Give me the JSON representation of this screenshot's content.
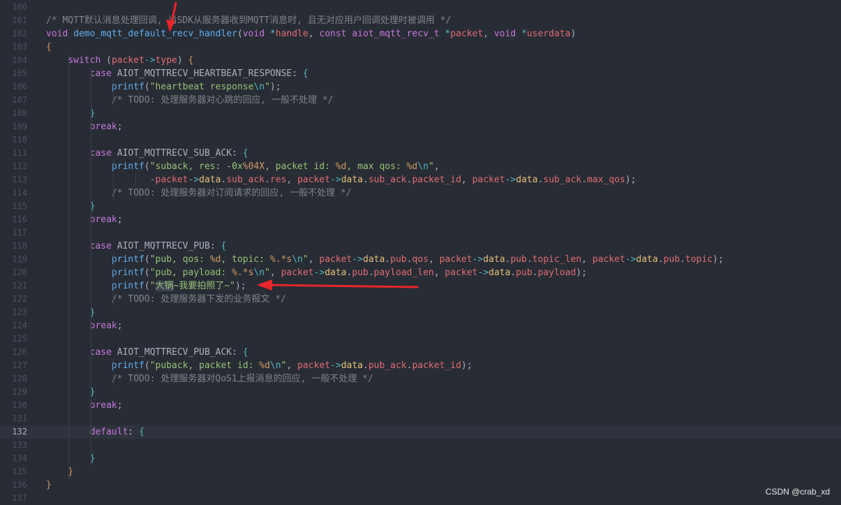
{
  "editor": {
    "current_line": 132,
    "colors": {
      "background": "#282c34",
      "comment": "#7f848e",
      "keyword": "#c678dd",
      "function": "#61afef",
      "string": "#98c379",
      "param": "#e06c75",
      "annotation_arrow": "#e8252a"
    },
    "lines": [
      {
        "num": "100",
        "tokens": []
      },
      {
        "num": "101",
        "tokens": [
          {
            "t": "comment",
            "v": "/* MQTT默认消息处理回调, 当SDK从服务器收到MQTT消息时, 且无对应用户回调处理时被调用 */"
          }
        ]
      },
      {
        "num": "102",
        "tokens": [
          {
            "t": "type",
            "v": "void"
          },
          {
            "t": "plain",
            "v": " "
          },
          {
            "t": "function",
            "v": "demo_mqtt_default_recv_handler"
          },
          {
            "t": "plain",
            "v": "("
          },
          {
            "t": "type",
            "v": "void"
          },
          {
            "t": "plain",
            "v": " "
          },
          {
            "t": "operator",
            "v": "*"
          },
          {
            "t": "param",
            "v": "handle"
          },
          {
            "t": "plain",
            "v": ", "
          },
          {
            "t": "type",
            "v": "const"
          },
          {
            "t": "plain",
            "v": " "
          },
          {
            "t": "type",
            "v": "aiot_mqtt_recv_t"
          },
          {
            "t": "plain",
            "v": " "
          },
          {
            "t": "operator",
            "v": "*"
          },
          {
            "t": "param",
            "v": "packet"
          },
          {
            "t": "plain",
            "v": ", "
          },
          {
            "t": "type",
            "v": "void"
          },
          {
            "t": "plain",
            "v": " "
          },
          {
            "t": "operator",
            "v": "*"
          },
          {
            "t": "param",
            "v": "userdata"
          },
          {
            "t": "plain",
            "v": ")"
          }
        ]
      },
      {
        "num": "103",
        "tokens": [
          {
            "t": "bracket",
            "v": "{"
          }
        ]
      },
      {
        "num": "104",
        "tokens": [
          {
            "t": "plain",
            "v": "    "
          },
          {
            "t": "keyword",
            "v": "switch"
          },
          {
            "t": "plain",
            "v": " ("
          },
          {
            "t": "param",
            "v": "packet"
          },
          {
            "t": "operator",
            "v": "->"
          },
          {
            "t": "field",
            "v": "type"
          },
          {
            "t": "plain",
            "v": ") "
          },
          {
            "t": "bracket",
            "v": "{"
          }
        ]
      },
      {
        "num": "105",
        "tokens": [
          {
            "t": "plain",
            "v": "        "
          },
          {
            "t": "keyword",
            "v": "case"
          },
          {
            "t": "plain",
            "v": " AIOT_MQTTRECV_HEARTBEAT_RESPONSE: "
          },
          {
            "t": "escape",
            "v": "{"
          }
        ]
      },
      {
        "num": "106",
        "tokens": [
          {
            "t": "plain",
            "v": "            "
          },
          {
            "t": "function",
            "v": "printf"
          },
          {
            "t": "plain",
            "v": "("
          },
          {
            "t": "string",
            "v": "\"heartbeat response"
          },
          {
            "t": "escape",
            "v": "\\n"
          },
          {
            "t": "string",
            "v": "\""
          },
          {
            "t": "plain",
            "v": ");"
          }
        ]
      },
      {
        "num": "107",
        "tokens": [
          {
            "t": "plain",
            "v": "            "
          },
          {
            "t": "comment",
            "v": "/* TODO: 处理服务器对心跳的回应, 一般不处理 */"
          }
        ]
      },
      {
        "num": "108",
        "tokens": [
          {
            "t": "plain",
            "v": "        "
          },
          {
            "t": "escape",
            "v": "}"
          }
        ]
      },
      {
        "num": "109",
        "tokens": [
          {
            "t": "plain",
            "v": "        "
          },
          {
            "t": "keyword",
            "v": "break"
          },
          {
            "t": "plain",
            "v": ";"
          }
        ]
      },
      {
        "num": "110",
        "tokens": []
      },
      {
        "num": "111",
        "tokens": [
          {
            "t": "plain",
            "v": "        "
          },
          {
            "t": "keyword",
            "v": "case"
          },
          {
            "t": "plain",
            "v": " AIOT_MQTTRECV_SUB_ACK: "
          },
          {
            "t": "escape",
            "v": "{"
          }
        ]
      },
      {
        "num": "112",
        "tokens": [
          {
            "t": "plain",
            "v": "            "
          },
          {
            "t": "function",
            "v": "printf"
          },
          {
            "t": "plain",
            "v": "("
          },
          {
            "t": "string",
            "v": "\"suback, res: -0x"
          },
          {
            "t": "format",
            "v": "%04X"
          },
          {
            "t": "string",
            "v": ", packet id: "
          },
          {
            "t": "format",
            "v": "%d"
          },
          {
            "t": "string",
            "v": ", max qos: "
          },
          {
            "t": "format",
            "v": "%d"
          },
          {
            "t": "escape",
            "v": "\\n"
          },
          {
            "t": "string",
            "v": "\""
          },
          {
            "t": "plain",
            "v": ","
          }
        ]
      },
      {
        "num": "113",
        "tokens": [
          {
            "t": "plain",
            "v": "                   "
          },
          {
            "t": "operator",
            "v": "-"
          },
          {
            "t": "param",
            "v": "packet"
          },
          {
            "t": "operator",
            "v": "->"
          },
          {
            "t": "constant",
            "v": "data"
          },
          {
            "t": "plain",
            "v": "."
          },
          {
            "t": "field",
            "v": "sub_ack"
          },
          {
            "t": "plain",
            "v": "."
          },
          {
            "t": "field",
            "v": "res"
          },
          {
            "t": "plain",
            "v": ", "
          },
          {
            "t": "param",
            "v": "packet"
          },
          {
            "t": "operator",
            "v": "->"
          },
          {
            "t": "constant",
            "v": "data"
          },
          {
            "t": "plain",
            "v": "."
          },
          {
            "t": "field",
            "v": "sub_ack"
          },
          {
            "t": "plain",
            "v": "."
          },
          {
            "t": "field",
            "v": "packet_id"
          },
          {
            "t": "plain",
            "v": ", "
          },
          {
            "t": "param",
            "v": "packet"
          },
          {
            "t": "operator",
            "v": "->"
          },
          {
            "t": "constant",
            "v": "data"
          },
          {
            "t": "plain",
            "v": "."
          },
          {
            "t": "field",
            "v": "sub_ack"
          },
          {
            "t": "plain",
            "v": "."
          },
          {
            "t": "field",
            "v": "max_qos"
          },
          {
            "t": "plain",
            "v": ");"
          }
        ]
      },
      {
        "num": "114",
        "tokens": [
          {
            "t": "plain",
            "v": "            "
          },
          {
            "t": "comment",
            "v": "/* TODO: 处理服务器对订阅请求的回应, 一般不处理 */"
          }
        ]
      },
      {
        "num": "115",
        "tokens": [
          {
            "t": "plain",
            "v": "        "
          },
          {
            "t": "escape",
            "v": "}"
          }
        ]
      },
      {
        "num": "116",
        "tokens": [
          {
            "t": "plain",
            "v": "        "
          },
          {
            "t": "keyword",
            "v": "break"
          },
          {
            "t": "plain",
            "v": ";"
          }
        ]
      },
      {
        "num": "117",
        "tokens": []
      },
      {
        "num": "118",
        "tokens": [
          {
            "t": "plain",
            "v": "        "
          },
          {
            "t": "keyword",
            "v": "case"
          },
          {
            "t": "plain",
            "v": " AIOT_MQTTRECV_PUB: "
          },
          {
            "t": "escape",
            "v": "{"
          }
        ]
      },
      {
        "num": "119",
        "tokens": [
          {
            "t": "plain",
            "v": "            "
          },
          {
            "t": "function",
            "v": "printf"
          },
          {
            "t": "plain",
            "v": "("
          },
          {
            "t": "string",
            "v": "\"pub, qos: "
          },
          {
            "t": "format",
            "v": "%d"
          },
          {
            "t": "string",
            "v": ", topic: "
          },
          {
            "t": "format",
            "v": "%.*s"
          },
          {
            "t": "escape",
            "v": "\\n"
          },
          {
            "t": "string",
            "v": "\""
          },
          {
            "t": "plain",
            "v": ", "
          },
          {
            "t": "param",
            "v": "packet"
          },
          {
            "t": "operator",
            "v": "->"
          },
          {
            "t": "constant",
            "v": "data"
          },
          {
            "t": "plain",
            "v": "."
          },
          {
            "t": "field",
            "v": "pub"
          },
          {
            "t": "plain",
            "v": "."
          },
          {
            "t": "field",
            "v": "qos"
          },
          {
            "t": "plain",
            "v": ", "
          },
          {
            "t": "param",
            "v": "packet"
          },
          {
            "t": "operator",
            "v": "->"
          },
          {
            "t": "constant",
            "v": "data"
          },
          {
            "t": "plain",
            "v": "."
          },
          {
            "t": "field",
            "v": "pub"
          },
          {
            "t": "plain",
            "v": "."
          },
          {
            "t": "field",
            "v": "topic_len"
          },
          {
            "t": "plain",
            "v": ", "
          },
          {
            "t": "param",
            "v": "packet"
          },
          {
            "t": "operator",
            "v": "->"
          },
          {
            "t": "constant",
            "v": "data"
          },
          {
            "t": "plain",
            "v": "."
          },
          {
            "t": "field",
            "v": "pub"
          },
          {
            "t": "plain",
            "v": "."
          },
          {
            "t": "field",
            "v": "topic"
          },
          {
            "t": "plain",
            "v": ");"
          }
        ]
      },
      {
        "num": "120",
        "tokens": [
          {
            "t": "plain",
            "v": "            "
          },
          {
            "t": "function",
            "v": "printf"
          },
          {
            "t": "plain",
            "v": "("
          },
          {
            "t": "string",
            "v": "\"pub, payload: "
          },
          {
            "t": "format",
            "v": "%.*s"
          },
          {
            "t": "escape",
            "v": "\\n"
          },
          {
            "t": "string",
            "v": "\""
          },
          {
            "t": "plain",
            "v": ", "
          },
          {
            "t": "param",
            "v": "packet"
          },
          {
            "t": "operator",
            "v": "->"
          },
          {
            "t": "constant",
            "v": "data"
          },
          {
            "t": "plain",
            "v": "."
          },
          {
            "t": "field",
            "v": "pub"
          },
          {
            "t": "plain",
            "v": "."
          },
          {
            "t": "field",
            "v": "payload_len"
          },
          {
            "t": "plain",
            "v": ", "
          },
          {
            "t": "param",
            "v": "packet"
          },
          {
            "t": "operator",
            "v": "->"
          },
          {
            "t": "constant",
            "v": "data"
          },
          {
            "t": "plain",
            "v": "."
          },
          {
            "t": "field",
            "v": "pub"
          },
          {
            "t": "plain",
            "v": "."
          },
          {
            "t": "field",
            "v": "payload"
          },
          {
            "t": "plain",
            "v": ");"
          }
        ]
      },
      {
        "num": "121",
        "tokens": [
          {
            "t": "plain",
            "v": "            "
          },
          {
            "t": "function",
            "v": "printf"
          },
          {
            "t": "plain",
            "v": "("
          },
          {
            "t": "string",
            "v": "\""
          },
          {
            "t": "selected",
            "v": "大锅"
          },
          {
            "t": "string",
            "v": "~我要拍照了~\""
          },
          {
            "t": "plain",
            "v": ");"
          }
        ]
      },
      {
        "num": "122",
        "tokens": [
          {
            "t": "plain",
            "v": "            "
          },
          {
            "t": "comment",
            "v": "/* TODO: 处理服务器下发的业务报文 */"
          }
        ]
      },
      {
        "num": "123",
        "tokens": [
          {
            "t": "plain",
            "v": "        "
          },
          {
            "t": "escape",
            "v": "}"
          }
        ]
      },
      {
        "num": "124",
        "tokens": [
          {
            "t": "plain",
            "v": "        "
          },
          {
            "t": "keyword",
            "v": "break"
          },
          {
            "t": "plain",
            "v": ";"
          }
        ]
      },
      {
        "num": "125",
        "tokens": []
      },
      {
        "num": "126",
        "tokens": [
          {
            "t": "plain",
            "v": "        "
          },
          {
            "t": "keyword",
            "v": "case"
          },
          {
            "t": "plain",
            "v": " AIOT_MQTTRECV_PUB_ACK: "
          },
          {
            "t": "escape",
            "v": "{"
          }
        ]
      },
      {
        "num": "127",
        "tokens": [
          {
            "t": "plain",
            "v": "            "
          },
          {
            "t": "function",
            "v": "printf"
          },
          {
            "t": "plain",
            "v": "("
          },
          {
            "t": "string",
            "v": "\"puback, packet id: "
          },
          {
            "t": "format",
            "v": "%d"
          },
          {
            "t": "escape",
            "v": "\\n"
          },
          {
            "t": "string",
            "v": "\""
          },
          {
            "t": "plain",
            "v": ", "
          },
          {
            "t": "param",
            "v": "packet"
          },
          {
            "t": "operator",
            "v": "->"
          },
          {
            "t": "constant",
            "v": "data"
          },
          {
            "t": "plain",
            "v": "."
          },
          {
            "t": "field",
            "v": "pub_ack"
          },
          {
            "t": "plain",
            "v": "."
          },
          {
            "t": "field",
            "v": "packet_id"
          },
          {
            "t": "plain",
            "v": ");"
          }
        ]
      },
      {
        "num": "128",
        "tokens": [
          {
            "t": "plain",
            "v": "            "
          },
          {
            "t": "comment",
            "v": "/* TODO: 处理服务器对QoS1上报消息的回应, 一般不处理 */"
          }
        ]
      },
      {
        "num": "129",
        "tokens": [
          {
            "t": "plain",
            "v": "        "
          },
          {
            "t": "escape",
            "v": "}"
          }
        ]
      },
      {
        "num": "130",
        "tokens": [
          {
            "t": "plain",
            "v": "        "
          },
          {
            "t": "keyword",
            "v": "break"
          },
          {
            "t": "plain",
            "v": ";"
          }
        ]
      },
      {
        "num": "131",
        "tokens": []
      },
      {
        "num": "132",
        "tokens": [
          {
            "t": "plain",
            "v": "        "
          },
          {
            "t": "keyword",
            "v": "default"
          },
          {
            "t": "plain",
            "v": ": "
          },
          {
            "t": "escape",
            "v": "{"
          }
        ]
      },
      {
        "num": "133",
        "tokens": []
      },
      {
        "num": "134",
        "tokens": [
          {
            "t": "plain",
            "v": "        "
          },
          {
            "t": "escape",
            "v": "}"
          }
        ]
      },
      {
        "num": "135",
        "tokens": [
          {
            "t": "plain",
            "v": "    "
          },
          {
            "t": "bracket",
            "v": "}"
          }
        ]
      },
      {
        "num": "136",
        "tokens": [
          {
            "t": "bracket",
            "v": "}"
          }
        ]
      },
      {
        "num": "137",
        "tokens": []
      }
    ]
  },
  "watermark": "CSDN @crab_xd",
  "annotations": [
    {
      "type": "arrow",
      "icon": "red-arrow-icon",
      "target_line": "102"
    },
    {
      "type": "arrow",
      "icon": "red-arrow-icon",
      "target_line": "121"
    }
  ]
}
